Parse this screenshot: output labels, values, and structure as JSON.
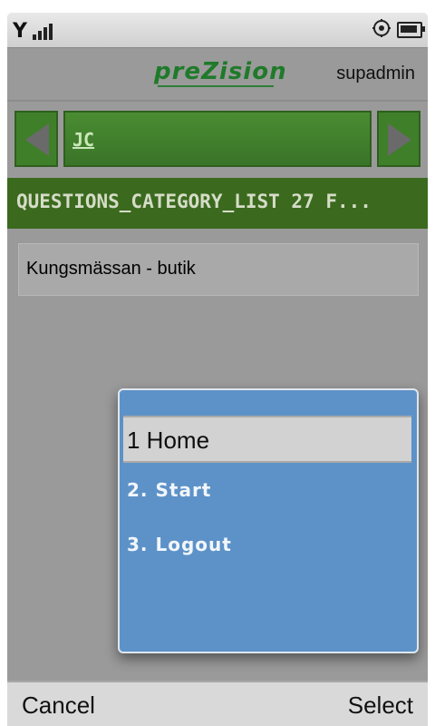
{
  "status_bar": {
    "signal_icon": "signal-bars-icon",
    "gear_icon": "gear-icon",
    "battery_icon": "battery-icon"
  },
  "header": {
    "logo_text": "preZision",
    "user_label": "supadmin",
    "brand_color": "#1f7a2a"
  },
  "navigator": {
    "left_arrow_icon": "arrow-left-icon",
    "right_arrow_icon": "arrow-right-icon",
    "current_label": "JC"
  },
  "category_bar": {
    "text": "QUESTIONS_CATEGORY_LIST  27 F..."
  },
  "list": {
    "items": [
      {
        "label": "Kungsmässan - butik"
      }
    ]
  },
  "menu": {
    "items": [
      {
        "label": "1 Home"
      },
      {
        "label": "2. Start"
      },
      {
        "label": "3. Logout"
      }
    ],
    "background_color": "#5d92c8",
    "selected_index": 0
  },
  "softkeys": {
    "left": "Cancel",
    "right": "Select"
  }
}
